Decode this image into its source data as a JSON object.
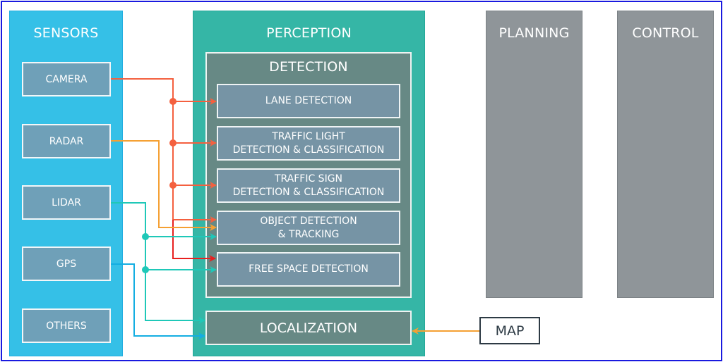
{
  "sensors": {
    "title": "SENSORS",
    "items": [
      "CAMERA",
      "RADAR",
      "LIDAR",
      "GPS",
      "OTHERS"
    ]
  },
  "perception": {
    "title": "PERCEPTION",
    "detection": {
      "title": "DETECTION",
      "items": [
        {
          "line1": "LANE DETECTION",
          "line2": ""
        },
        {
          "line1": "TRAFFIC LIGHT",
          "line2": "DETECTION & CLASSIFICATION"
        },
        {
          "line1": "TRAFFIC SIGN",
          "line2": "DETECTION & CLASSIFICATION"
        },
        {
          "line1": "OBJECT DETECTION",
          "line2": "& TRACKING"
        },
        {
          "line1": "FREE SPACE DETECTION",
          "line2": ""
        }
      ]
    },
    "localization": "LOCALIZATION"
  },
  "planning": {
    "title": "PLANNING"
  },
  "control": {
    "title": "CONTROL"
  },
  "map": {
    "label": "MAP"
  },
  "connections": [
    {
      "from": "CAMERA",
      "to": [
        "LANE DETECTION",
        "TRAFFIC LIGHT DETECTION & CLASSIFICATION",
        "TRAFFIC SIGN DETECTION & CLASSIFICATION",
        "OBJECT DETECTION & TRACKING",
        "FREE SPACE DETECTION"
      ]
    },
    {
      "from": "RADAR",
      "to": [
        "OBJECT DETECTION & TRACKING"
      ]
    },
    {
      "from": "LIDAR",
      "to": [
        "OBJECT DETECTION & TRACKING",
        "FREE SPACE DETECTION",
        "LOCALIZATION"
      ]
    },
    {
      "from": "GPS",
      "to": [
        "LOCALIZATION"
      ]
    },
    {
      "from": "MAP",
      "to": [
        "LOCALIZATION"
      ]
    }
  ],
  "colors": {
    "camera": "#f4603f",
    "camera_free_space": "#e8201f",
    "radar": "#f5a033",
    "lidar": "#1fc8b8",
    "gps": "#14aee2",
    "map": "#f5a033",
    "sensors_bg": "#35c0e7",
    "perception_bg": "#35b6a6",
    "detection_bg": "#678985",
    "planning_bg": "#8f9599"
  }
}
